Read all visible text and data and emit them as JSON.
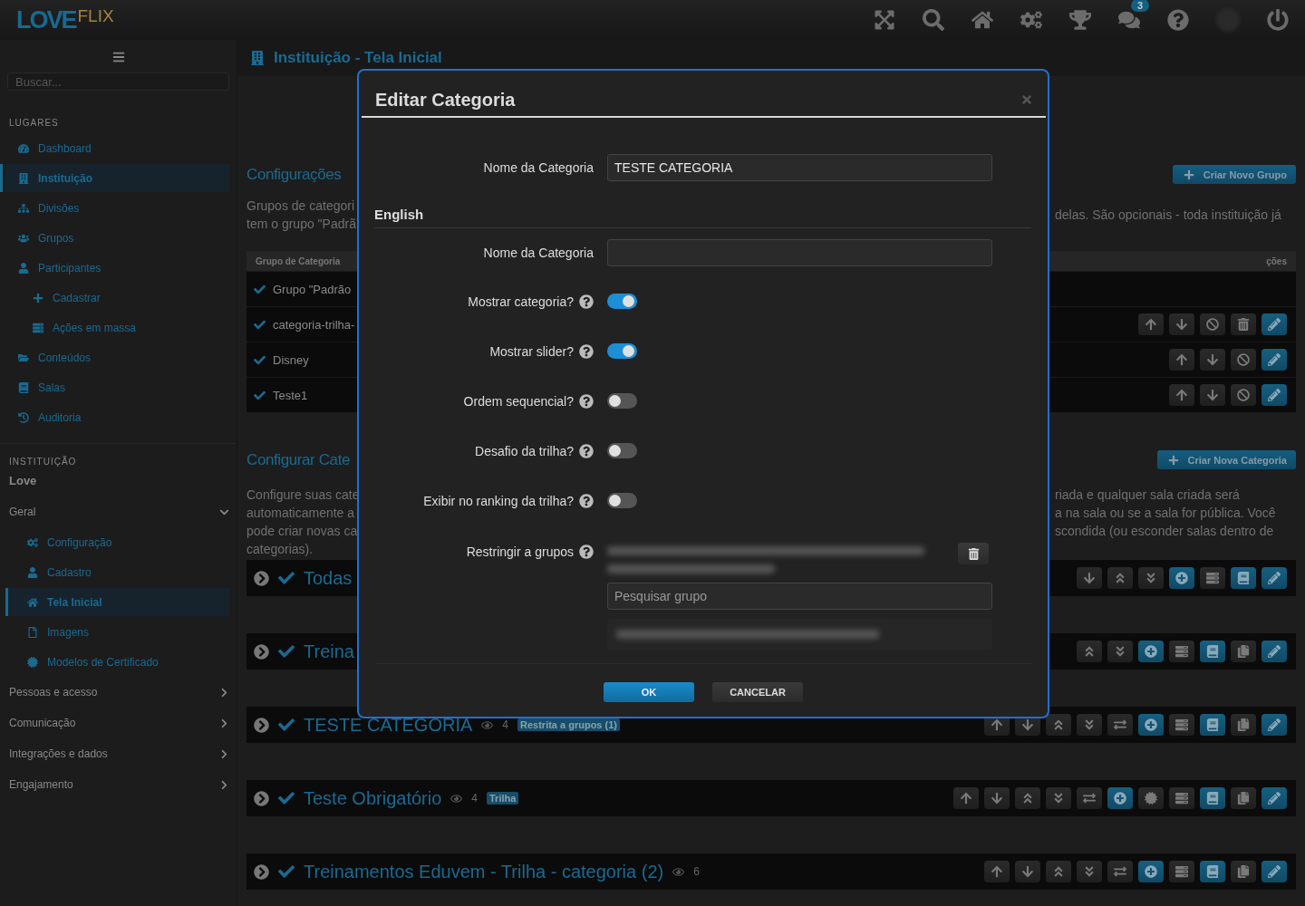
{
  "topbar": {
    "logo_primary": "LOVE",
    "logo_secondary": "FLIX",
    "notifications_badge": "3"
  },
  "sidebar": {
    "search": {
      "placeholder": "Buscar..."
    },
    "places": {
      "title": "LUGARES",
      "items": [
        {
          "label": "Dashboard",
          "selected": false
        },
        {
          "label": "Instituição",
          "selected": true
        },
        {
          "label": "Divisões",
          "selected": false
        },
        {
          "label": "Grupos",
          "selected": false
        },
        {
          "label": "Participantes",
          "selected": false,
          "children": [
            {
              "label": "Cadastrar",
              "selected": false
            },
            {
              "label": "Ações em massa",
              "selected": false
            }
          ]
        },
        {
          "label": "Conteúdos",
          "selected": false
        },
        {
          "label": "Salas",
          "selected": false
        },
        {
          "label": "Auditoria",
          "selected": false
        }
      ]
    },
    "institution": {
      "title": "INSTITUIÇÃO",
      "name": "Love",
      "groups": [
        {
          "label": "Geral",
          "expanded": true,
          "children": [
            {
              "label": "Configuração",
              "selected": false
            },
            {
              "label": "Cadastro",
              "selected": false
            },
            {
              "label": "Tela Inicial",
              "selected": true
            },
            {
              "label": "Imagens",
              "selected": false
            },
            {
              "label": "Modelos de Certificado",
              "selected": false
            }
          ]
        },
        {
          "label": "Pessoas e acesso",
          "expanded": false
        },
        {
          "label": "Comunicação",
          "expanded": false
        },
        {
          "label": "Integrações e dados",
          "expanded": false
        },
        {
          "label": "Engajamento",
          "expanded": false
        }
      ]
    }
  },
  "page_header": {
    "title": "Instituição - Tela Inicial"
  },
  "groups_section": {
    "title": "Configurações",
    "create_button": "Criar Novo Grupo",
    "description_left": [
      "Grupos de categori",
      "tem o grupo \"Padrã"
    ],
    "description_right": [
      "delas. São opcionais - toda instituição já"
    ],
    "table": {
      "columns": [
        "Grupo de Categoria",
        "ções"
      ],
      "rows": [
        {
          "name": "Grupo \"Padrão",
          "actions": []
        },
        {
          "name": "categoria-trilha-",
          "actions": [
            {
              "kind": "up"
            },
            {
              "kind": "down"
            },
            {
              "kind": "block"
            },
            {
              "kind": "delete"
            },
            {
              "kind": "edit"
            }
          ]
        },
        {
          "name": "Disney",
          "actions": [
            {
              "kind": "up"
            },
            {
              "kind": "down"
            },
            {
              "kind": "block"
            },
            {
              "kind": "edit"
            }
          ]
        },
        {
          "name": "Teste1",
          "actions": [
            {
              "kind": "up"
            },
            {
              "kind": "down"
            },
            {
              "kind": "block"
            },
            {
              "kind": "edit"
            }
          ]
        }
      ]
    }
  },
  "categories_section": {
    "title": "Configurar Cate",
    "create_button": "Criar Nova Categoria",
    "description_left": [
      "Configure suas cate",
      "automaticamente a",
      "pode criar novas ca",
      "categorias)."
    ],
    "description_right": [
      "riada e qualquer sala criada será",
      "a na sala ou se a sala for pública. Você",
      "scondida (ou esconder salas dentro de"
    ],
    "rows": [
      {
        "title": "Todas",
        "actions": [
          {
            "kind": "down"
          },
          {
            "kind": "top"
          },
          {
            "kind": "bottom"
          },
          {
            "kind": "add"
          },
          {
            "kind": "stack"
          },
          {
            "kind": "book"
          },
          {
            "kind": "edit"
          }
        ]
      },
      {
        "title": "Treina",
        "actions": [
          {
            "kind": "top"
          },
          {
            "kind": "bottom"
          },
          {
            "kind": "add"
          },
          {
            "kind": "stack"
          },
          {
            "kind": "book"
          },
          {
            "kind": "copy"
          },
          {
            "kind": "edit"
          }
        ]
      },
      {
        "title": "TESTE CATEGORIA",
        "views": "4",
        "badge": "Restrita a grupos (1)",
        "actions": [
          {
            "kind": "up"
          },
          {
            "kind": "down"
          },
          {
            "kind": "top"
          },
          {
            "kind": "bottom"
          },
          {
            "kind": "swap"
          },
          {
            "kind": "add"
          },
          {
            "kind": "stack"
          },
          {
            "kind": "book"
          },
          {
            "kind": "copy"
          },
          {
            "kind": "edit"
          }
        ]
      },
      {
        "title": "Teste Obrigatório",
        "views": "4",
        "badge": "Trilha",
        "actions": [
          {
            "kind": "up"
          },
          {
            "kind": "down"
          },
          {
            "kind": "top"
          },
          {
            "kind": "bottom"
          },
          {
            "kind": "swap"
          },
          {
            "kind": "add"
          },
          {
            "kind": "badge"
          },
          {
            "kind": "stack"
          },
          {
            "kind": "book"
          },
          {
            "kind": "copy"
          },
          {
            "kind": "edit"
          }
        ]
      },
      {
        "title": "Treinamentos Eduvem - Trilha - categoria (2)",
        "views": "6",
        "actions": [
          {
            "kind": "up"
          },
          {
            "kind": "down"
          },
          {
            "kind": "top"
          },
          {
            "kind": "bottom"
          },
          {
            "kind": "swap"
          },
          {
            "kind": "add"
          },
          {
            "kind": "stack"
          },
          {
            "kind": "book"
          },
          {
            "kind": "copy"
          },
          {
            "kind": "edit"
          }
        ]
      }
    ]
  },
  "modal": {
    "title": "Editar Categoria",
    "fields": [
      {
        "kind": "text",
        "label": "Nome da Categoria",
        "value": "TESTE CATEGORIA"
      },
      {
        "kind": "heading",
        "label": "English"
      },
      {
        "kind": "text",
        "label": "Nome da Categoria"
      },
      {
        "kind": "toggle",
        "label": "Mostrar categoria?",
        "on": true
      },
      {
        "kind": "toggle",
        "label": "Mostrar slider?",
        "on": true
      },
      {
        "kind": "toggle",
        "label": "Ordem sequencial?",
        "on": false
      },
      {
        "kind": "toggle",
        "label": "Desafio da trilha?",
        "on": false
      },
      {
        "kind": "toggle",
        "label": "Exibir no ranking da trilha?",
        "on": false
      },
      {
        "kind": "groups",
        "label": "Restringir a grupos",
        "placeholder": "Pesquisar grupo"
      }
    ],
    "buttons": [
      {
        "label": "OK",
        "kind": "primary"
      },
      {
        "label": "CANCELAR",
        "kind": "secondary"
      }
    ]
  }
}
